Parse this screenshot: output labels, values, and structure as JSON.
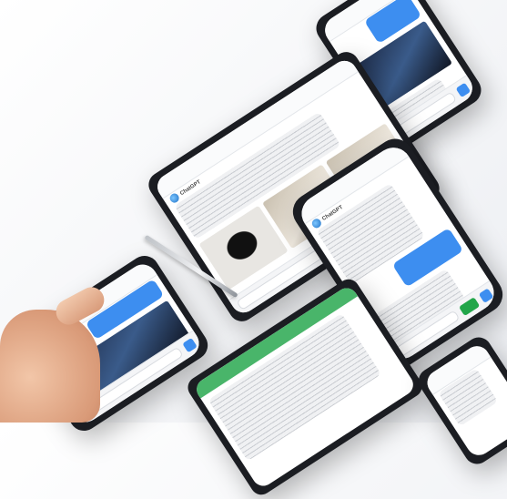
{
  "image": {
    "description": "",
    "labels": {
      "header": "ChatGPT"
    },
    "bot_name": "ChatGPT",
    "colors": {
      "accent": "#3d8ef0",
      "green": "#49b56a",
      "device": "#1b1d22"
    }
  }
}
